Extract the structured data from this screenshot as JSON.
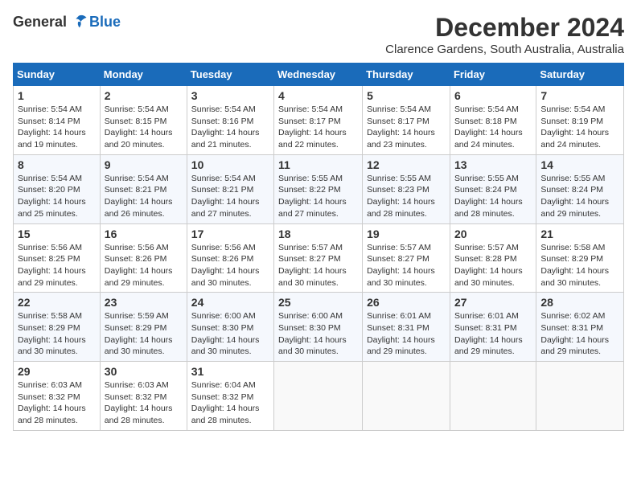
{
  "logo": {
    "general": "General",
    "blue": "Blue"
  },
  "title": "December 2024",
  "location": "Clarence Gardens, South Australia, Australia",
  "headers": [
    "Sunday",
    "Monday",
    "Tuesday",
    "Wednesday",
    "Thursday",
    "Friday",
    "Saturday"
  ],
  "weeks": [
    [
      {
        "day": "1",
        "sunrise": "5:54 AM",
        "sunset": "8:14 PM",
        "daylight": "14 hours and 19 minutes."
      },
      {
        "day": "2",
        "sunrise": "5:54 AM",
        "sunset": "8:15 PM",
        "daylight": "14 hours and 20 minutes."
      },
      {
        "day": "3",
        "sunrise": "5:54 AM",
        "sunset": "8:16 PM",
        "daylight": "14 hours and 21 minutes."
      },
      {
        "day": "4",
        "sunrise": "5:54 AM",
        "sunset": "8:17 PM",
        "daylight": "14 hours and 22 minutes."
      },
      {
        "day": "5",
        "sunrise": "5:54 AM",
        "sunset": "8:17 PM",
        "daylight": "14 hours and 23 minutes."
      },
      {
        "day": "6",
        "sunrise": "5:54 AM",
        "sunset": "8:18 PM",
        "daylight": "14 hours and 24 minutes."
      },
      {
        "day": "7",
        "sunrise": "5:54 AM",
        "sunset": "8:19 PM",
        "daylight": "14 hours and 24 minutes."
      }
    ],
    [
      {
        "day": "8",
        "sunrise": "5:54 AM",
        "sunset": "8:20 PM",
        "daylight": "14 hours and 25 minutes."
      },
      {
        "day": "9",
        "sunrise": "5:54 AM",
        "sunset": "8:21 PM",
        "daylight": "14 hours and 26 minutes."
      },
      {
        "day": "10",
        "sunrise": "5:54 AM",
        "sunset": "8:21 PM",
        "daylight": "14 hours and 27 minutes."
      },
      {
        "day": "11",
        "sunrise": "5:55 AM",
        "sunset": "8:22 PM",
        "daylight": "14 hours and 27 minutes."
      },
      {
        "day": "12",
        "sunrise": "5:55 AM",
        "sunset": "8:23 PM",
        "daylight": "14 hours and 28 minutes."
      },
      {
        "day": "13",
        "sunrise": "5:55 AM",
        "sunset": "8:24 PM",
        "daylight": "14 hours and 28 minutes."
      },
      {
        "day": "14",
        "sunrise": "5:55 AM",
        "sunset": "8:24 PM",
        "daylight": "14 hours and 29 minutes."
      }
    ],
    [
      {
        "day": "15",
        "sunrise": "5:56 AM",
        "sunset": "8:25 PM",
        "daylight": "14 hours and 29 minutes."
      },
      {
        "day": "16",
        "sunrise": "5:56 AM",
        "sunset": "8:26 PM",
        "daylight": "14 hours and 29 minutes."
      },
      {
        "day": "17",
        "sunrise": "5:56 AM",
        "sunset": "8:26 PM",
        "daylight": "14 hours and 30 minutes."
      },
      {
        "day": "18",
        "sunrise": "5:57 AM",
        "sunset": "8:27 PM",
        "daylight": "14 hours and 30 minutes."
      },
      {
        "day": "19",
        "sunrise": "5:57 AM",
        "sunset": "8:27 PM",
        "daylight": "14 hours and 30 minutes."
      },
      {
        "day": "20",
        "sunrise": "5:57 AM",
        "sunset": "8:28 PM",
        "daylight": "14 hours and 30 minutes."
      },
      {
        "day": "21",
        "sunrise": "5:58 AM",
        "sunset": "8:29 PM",
        "daylight": "14 hours and 30 minutes."
      }
    ],
    [
      {
        "day": "22",
        "sunrise": "5:58 AM",
        "sunset": "8:29 PM",
        "daylight": "14 hours and 30 minutes."
      },
      {
        "day": "23",
        "sunrise": "5:59 AM",
        "sunset": "8:29 PM",
        "daylight": "14 hours and 30 minutes."
      },
      {
        "day": "24",
        "sunrise": "6:00 AM",
        "sunset": "8:30 PM",
        "daylight": "14 hours and 30 minutes."
      },
      {
        "day": "25",
        "sunrise": "6:00 AM",
        "sunset": "8:30 PM",
        "daylight": "14 hours and 30 minutes."
      },
      {
        "day": "26",
        "sunrise": "6:01 AM",
        "sunset": "8:31 PM",
        "daylight": "14 hours and 29 minutes."
      },
      {
        "day": "27",
        "sunrise": "6:01 AM",
        "sunset": "8:31 PM",
        "daylight": "14 hours and 29 minutes."
      },
      {
        "day": "28",
        "sunrise": "6:02 AM",
        "sunset": "8:31 PM",
        "daylight": "14 hours and 29 minutes."
      }
    ],
    [
      {
        "day": "29",
        "sunrise": "6:03 AM",
        "sunset": "8:32 PM",
        "daylight": "14 hours and 28 minutes."
      },
      {
        "day": "30",
        "sunrise": "6:03 AM",
        "sunset": "8:32 PM",
        "daylight": "14 hours and 28 minutes."
      },
      {
        "day": "31",
        "sunrise": "6:04 AM",
        "sunset": "8:32 PM",
        "daylight": "14 hours and 28 minutes."
      },
      null,
      null,
      null,
      null
    ]
  ]
}
